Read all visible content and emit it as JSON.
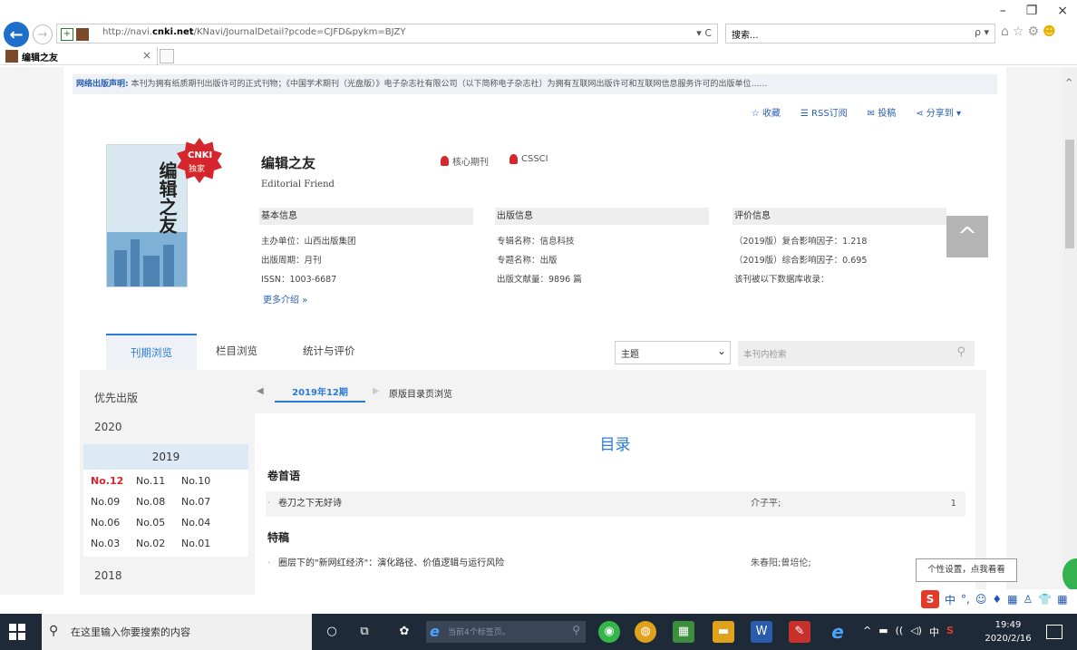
{
  "browser": {
    "url_prefix": "http://navi.",
    "url_domain": "cnki.net",
    "url_path": "/KNavi/JournalDetail?pcode=CJFD&pykm=BJZY",
    "address_tools": "▾ C",
    "search_placeholder": "搜索...",
    "search_tools": "ρ ▾",
    "tab_title": "编辑之友",
    "tab_close": "×",
    "window_controls": [
      "–",
      "❐",
      "×"
    ]
  },
  "page": {
    "notice_label": "网络出版声明:",
    "notice_text": "本刊为拥有纸质期刊出版许可的正式刊物；《中国学术期刊（光盘版）》电子杂志社有限公司（以下简称电子杂志社）为拥有互联网出版许可和互联网信息服务许可的出版单位……",
    "actions": [
      "☆ 收藏",
      "☰ RSS订阅",
      "✉ 投稿",
      "⋖ 分享到 ▾"
    ],
    "badge_line1": "CNKI",
    "badge_line2": "独家",
    "cover_title": "编辑之友",
    "journal_title": "编辑之友",
    "journal_english": "Editorial Friend",
    "tags": [
      "核心期刊",
      "CSSCI"
    ],
    "sections": {
      "basic": {
        "title": "基本信息",
        "lines": [
          "主办单位：山西出版集团",
          "出版周期：月刊",
          "ISSN：1003-6687"
        ]
      },
      "publish": {
        "title": "出版信息",
        "lines": [
          "专辑名称：信息科技",
          "专题名称：出版",
          "出版文献量：9896 篇"
        ]
      },
      "eval": {
        "title": "评价信息",
        "lines": [
          "（2019版）复合影响因子：1.218",
          "（2019版）综合影响因子：0.695",
          "该刊被以下数据库收录："
        ]
      }
    },
    "more_intro": "更多介绍 »",
    "back_to_top": "^",
    "tabs": [
      "刊期浏览",
      "栏目浏览",
      "统计与评价"
    ],
    "filter_value": "主题",
    "filter_caret": "⌄",
    "search_placeholder": "本刊内检索",
    "left_nav": {
      "priority": "优先出版",
      "year_2020": "2020",
      "year_2019": "2019",
      "issues": [
        [
          "No.12",
          "No.11",
          "No.10"
        ],
        [
          "No.09",
          "No.08",
          "No.07"
        ],
        [
          "No.06",
          "No.05",
          "No.04"
        ],
        [
          "No.03",
          "No.02",
          "No.01"
        ]
      ],
      "year_2018": "2018"
    },
    "issue_bar": {
      "prev": "◀",
      "current": "2019年12期",
      "next": "▶",
      "original": "原版目录页浏览"
    },
    "toc": {
      "title": "目录",
      "sections": [
        {
          "heading": "卷首语",
          "items": [
            {
              "title": "卷刀之下无好诗",
              "author": "介子平;",
              "page": "1"
            }
          ]
        },
        {
          "heading": "特稿",
          "items": [
            {
              "title": "圈层下的\"新网红经济\"：演化路径、价值逻辑与运行风险",
              "author": "朱春阳;曾培伦;",
              "page": ""
            }
          ]
        }
      ]
    }
  },
  "overlay": {
    "tooltip": "个性设置，点我看看",
    "ime_icons": [
      "中",
      "°,",
      "☺",
      "♦",
      "▦",
      "♙",
      "👕",
      "▦"
    ]
  },
  "taskbar": {
    "search_placeholder": "在这里输入你要搜索的内容",
    "browser_task_text": "当前4个标签页。",
    "tray": [
      "^",
      "▬",
      "((",
      "◁)",
      "中",
      "S"
    ],
    "time": "19:49",
    "date": "2020/2/16"
  }
}
